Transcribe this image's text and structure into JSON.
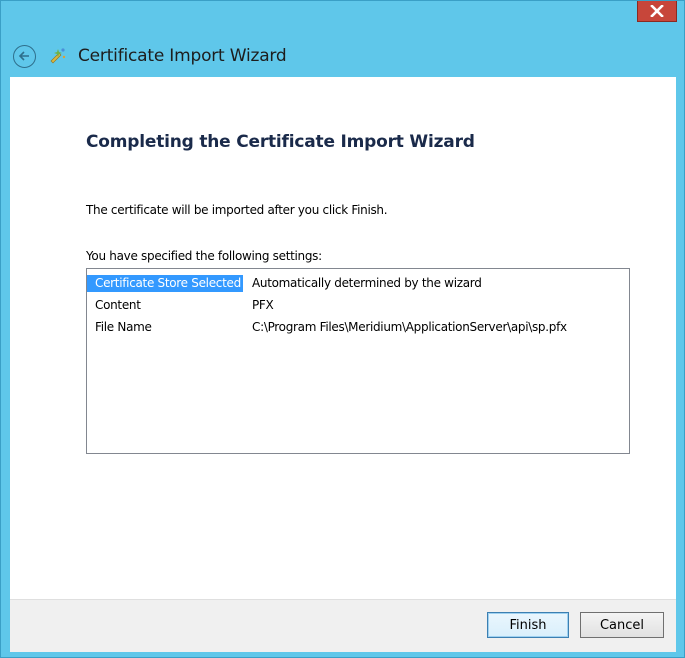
{
  "window": {
    "title": "Certificate Import Wizard",
    "close_label": "x"
  },
  "content": {
    "heading": "Completing the Certificate Import Wizard",
    "description": "The certificate will be imported after you click Finish.",
    "settings_label": "You have specified the following settings:",
    "settings": [
      {
        "key": "Certificate Store Selected",
        "value": "Automatically determined by the wizard",
        "selected": true
      },
      {
        "key": "Content",
        "value": "PFX",
        "selected": false
      },
      {
        "key": "File Name",
        "value": "C:\\Program Files\\Meridium\\ApplicationServer\\api\\sp.pfx",
        "selected": false
      }
    ]
  },
  "footer": {
    "finish_label": "Finish",
    "cancel_label": "Cancel"
  },
  "icons": {
    "back": "back-arrow-icon",
    "wizard": "certificate-icon",
    "close": "close-icon"
  },
  "colors": {
    "frame": "#5fc7ea",
    "close_button": "#c7463a",
    "selection": "#3399ff"
  }
}
